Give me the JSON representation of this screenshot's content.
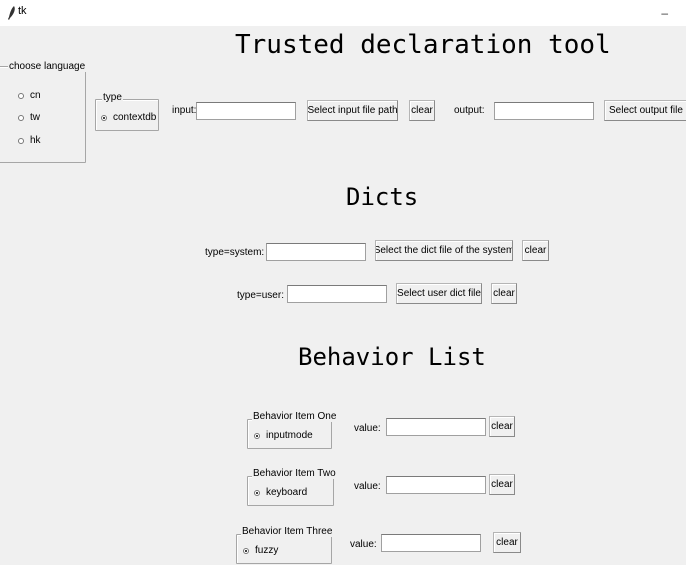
{
  "window": {
    "title": "tk",
    "minimize_label": "–"
  },
  "header": {
    "title": "Trusted declaration tool"
  },
  "language": {
    "legend": "choose language",
    "options": [
      "cn",
      "tw",
      "hk"
    ],
    "selected": null
  },
  "type_group": {
    "legend": "type",
    "option": "contextdb"
  },
  "io": {
    "input_label": "input:",
    "input_value": "",
    "select_input_button": "Select input file path",
    "clear_button": "clear",
    "output_label": "output:",
    "output_value": "",
    "select_output_button": "Select output file pa"
  },
  "dicts": {
    "title": "Dicts",
    "system_label": "type=system:",
    "system_value": "",
    "select_system_button": "Select the dict file of the system",
    "system_clear": "clear",
    "user_label": "type=user:",
    "user_value": "",
    "select_user_button": "Select user dict file",
    "user_clear": "clear"
  },
  "behavior": {
    "title": "Behavior List",
    "items": [
      {
        "legend": "Behavior Item One",
        "option": "inputmode",
        "value_label": "value:",
        "value": "",
        "clear": "clear"
      },
      {
        "legend": "Behavior Item Two",
        "option": "keyboard",
        "value_label": "value:",
        "value": "",
        "clear": "clear"
      },
      {
        "legend": "Behavior Item Three",
        "option": "fuzzy",
        "value_label": "value:",
        "value": "",
        "clear": "clear"
      }
    ]
  }
}
